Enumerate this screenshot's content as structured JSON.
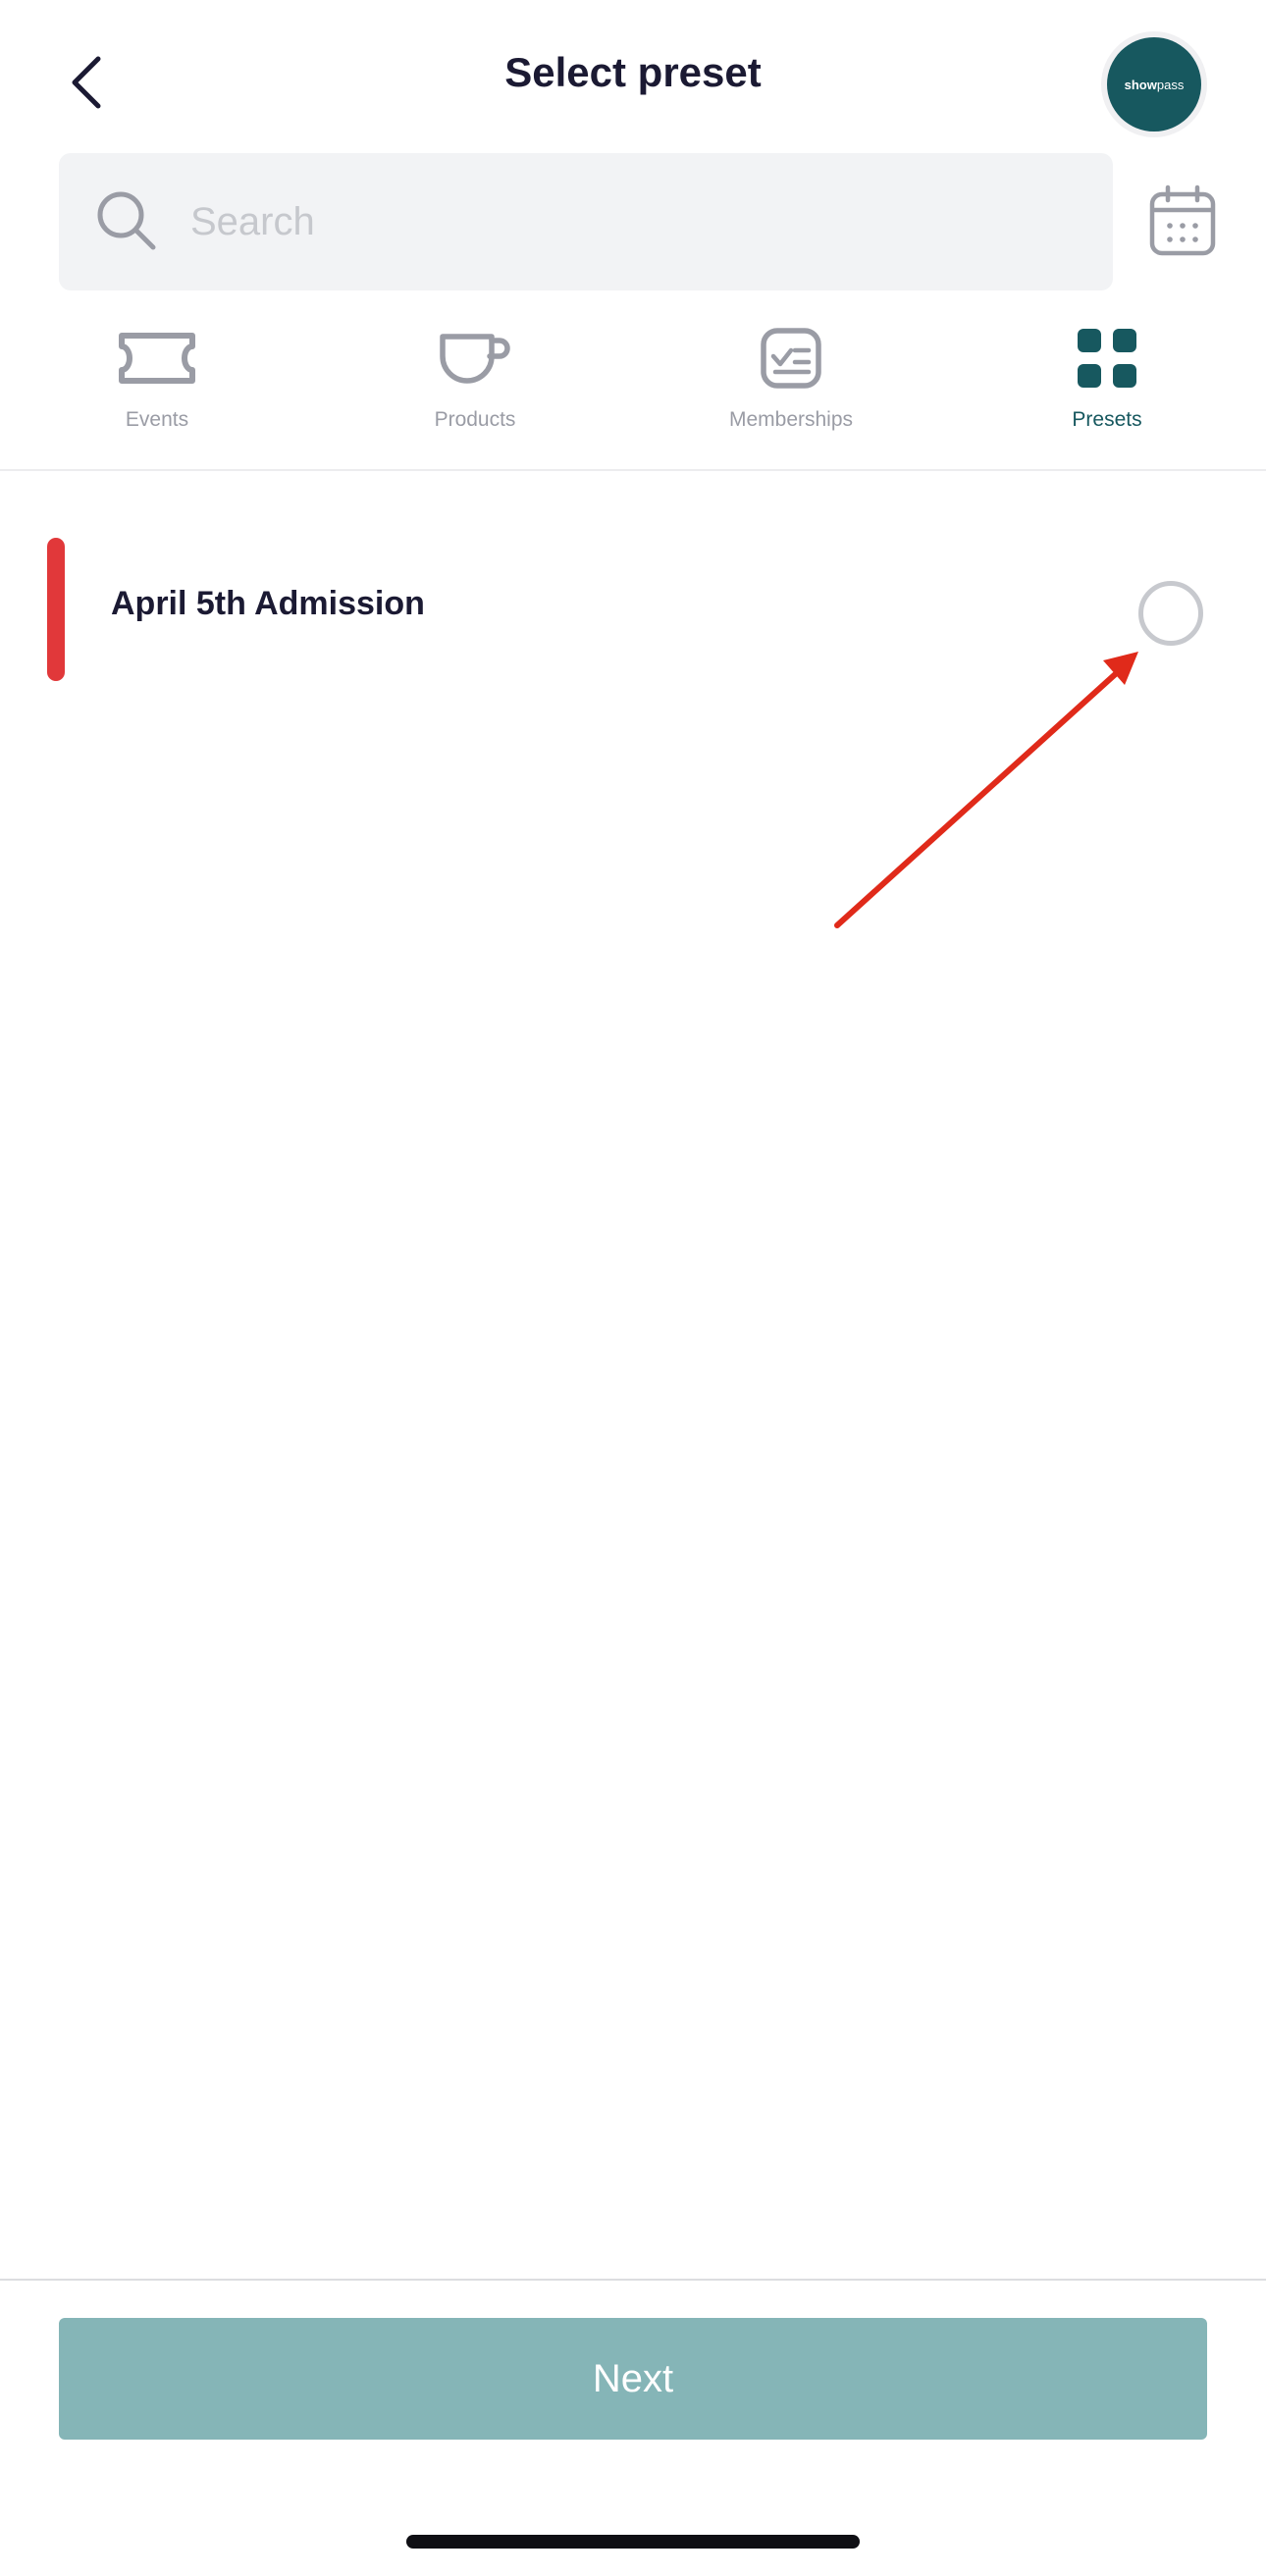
{
  "header": {
    "title": "Select preset",
    "logo_text_bold": "show",
    "logo_text_light": "pass",
    "back_icon": "chevron-left-icon"
  },
  "search": {
    "placeholder": "Search",
    "value": "",
    "icon": "search-icon",
    "calendar_icon": "calendar-icon"
  },
  "tabs": [
    {
      "label": "Events",
      "icon": "ticket-icon",
      "active": false
    },
    {
      "label": "Products",
      "icon": "cup-icon",
      "active": false
    },
    {
      "label": "Memberships",
      "icon": "membership-icon",
      "active": false
    },
    {
      "label": "Presets",
      "icon": "grid-icon",
      "active": true
    }
  ],
  "presets": [
    {
      "title": "April 5th Admission",
      "selected": false,
      "accent_color": "#e1383a"
    }
  ],
  "footer": {
    "next_label": "Next"
  },
  "colors": {
    "brand": "#17585f",
    "button_disabled": "#85b5b7",
    "annotation": "#e02a1a"
  }
}
